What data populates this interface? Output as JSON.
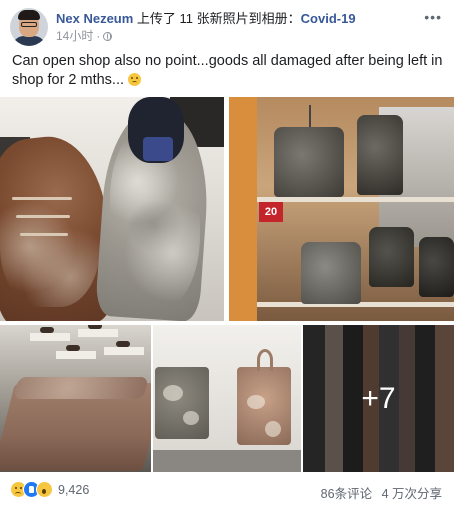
{
  "post": {
    "author": "Nex Nezeum",
    "action": " 上传了 11 张新照片到相册：",
    "album": "Covid-19",
    "time": "14小时",
    "text": "Can open shop also no point...goods all damaged after being left in shop for 2 mths...",
    "emoji": "sad-face-emoji",
    "more_photos": "+7"
  },
  "reactions": {
    "icons": [
      "crying-face-icon",
      "like-icon",
      "wow-icon"
    ],
    "count": "9,426"
  },
  "stats": {
    "comments": "86条评论",
    "shares": "4 万次分享"
  },
  "colors": {
    "link": "#385898",
    "secondary_text": "#606770",
    "like_blue": "#2078f4",
    "reaction_yellow": "#f7c641"
  }
}
